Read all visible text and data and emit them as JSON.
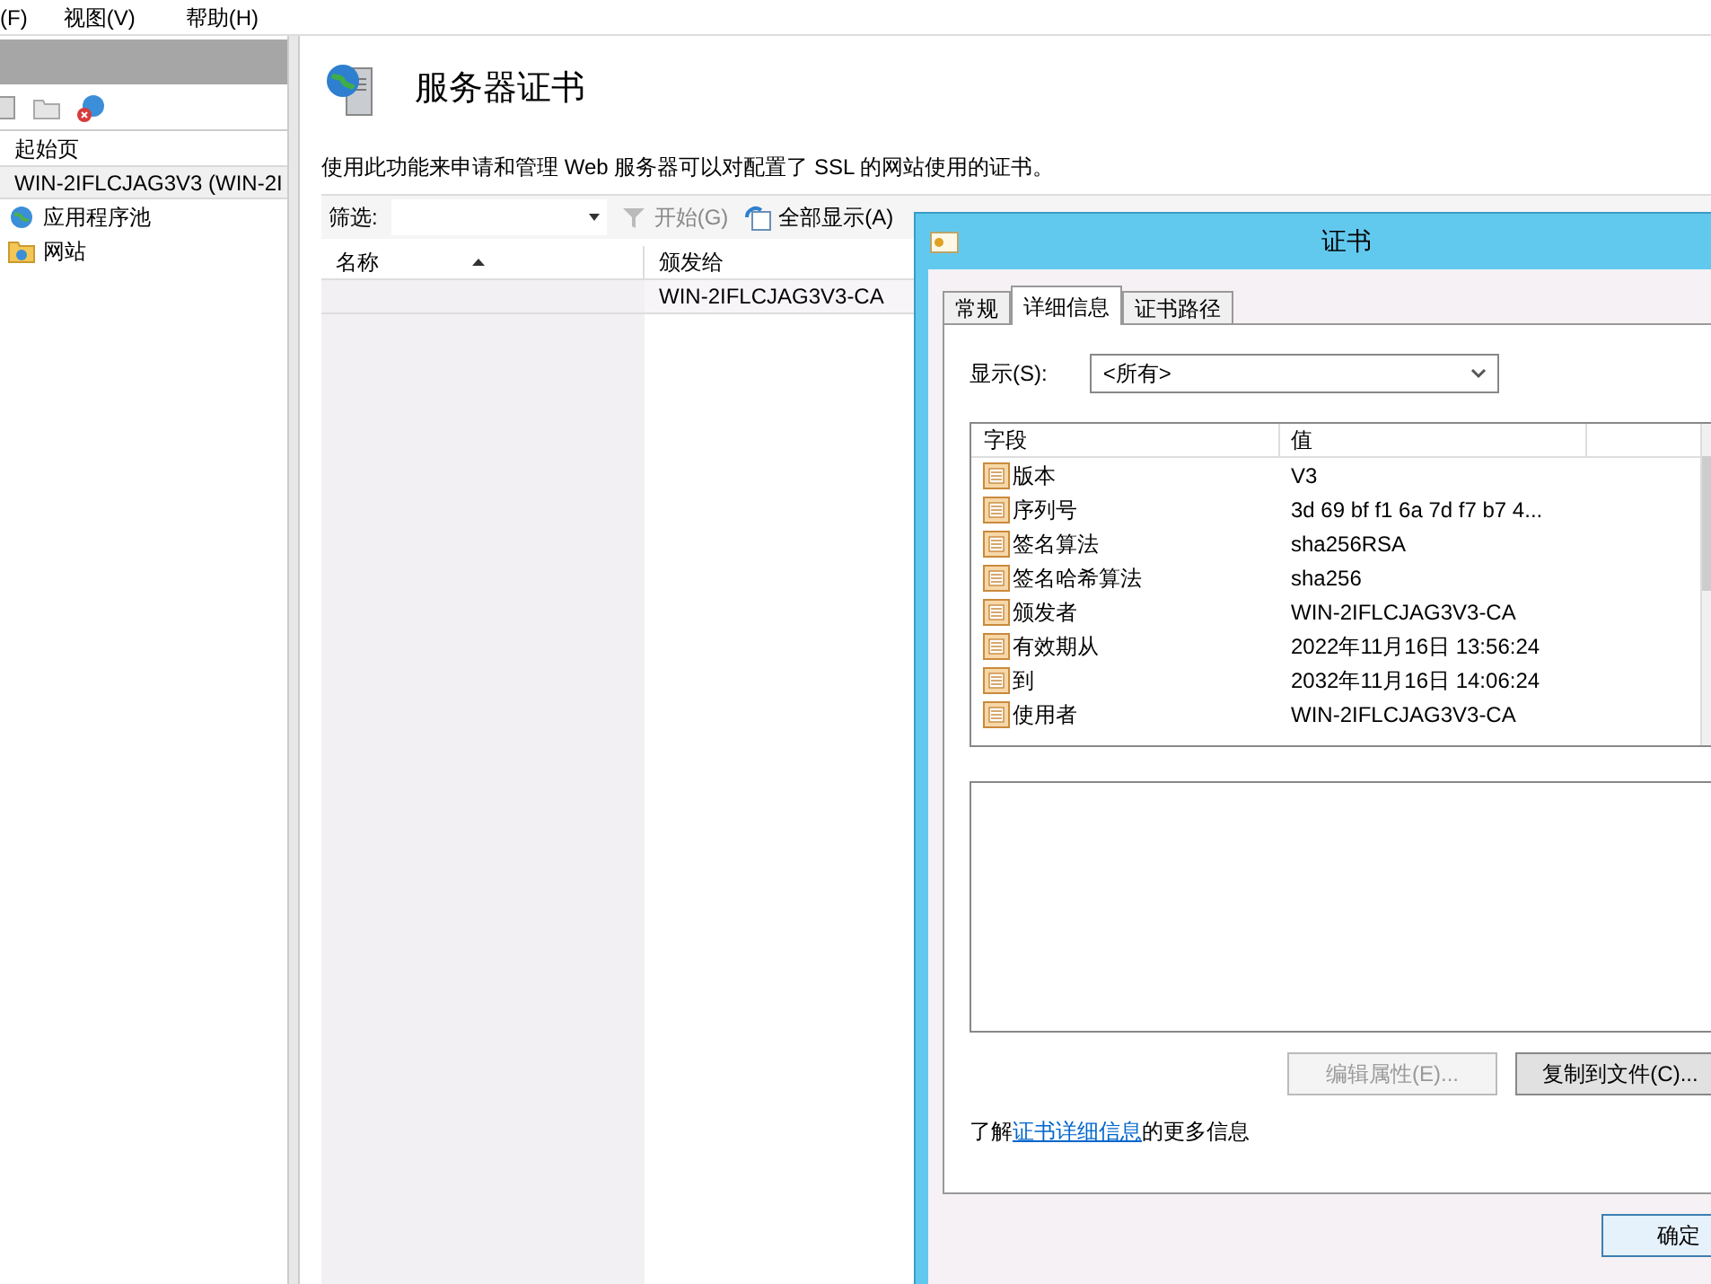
{
  "menu": [
    "(F)",
    "视图(V)",
    "帮助(H)"
  ],
  "tree": [
    {
      "label": "起始页",
      "selected": false
    },
    {
      "label": "WIN-2IFLCJAG3V3 (WIN-2I",
      "selected": true,
      "children": [
        {
          "label": "应用程序池",
          "selected": false,
          "kind": "pool"
        },
        {
          "label": "网站",
          "selected": false,
          "kind": "sites"
        }
      ]
    }
  ],
  "page": {
    "title": "服务器证书",
    "description": "使用此功能来申请和管理 Web 服务器可以对配置了 SSL 的网站使用的证书。"
  },
  "filter": {
    "label": "筛选:",
    "start": "开始(G)",
    "show_all": "全部显示(A)"
  },
  "table": {
    "columns": [
      "名称",
      "颁发给"
    ],
    "rows": [
      [
        "",
        "WIN-2IFLCJAG3V3-CA"
      ]
    ]
  },
  "dialog": {
    "title": "证书",
    "tabs": [
      {
        "label": "常规",
        "selected": false
      },
      {
        "label": "详细信息",
        "selected": true
      },
      {
        "label": "证书路径",
        "selected": false
      }
    ],
    "show_label": "显示(S):",
    "show_value": "<所有>",
    "columns": [
      "字段",
      "值"
    ],
    "fields": [
      {
        "field": "版本",
        "value": "V3"
      },
      {
        "field": "序列号",
        "value": "3d 69 bf f1 6a 7d f7 b7 4..."
      },
      {
        "field": "签名算法",
        "value": "sha256RSA"
      },
      {
        "field": "签名哈希算法",
        "value": "sha256"
      },
      {
        "field": "颁发者",
        "value": "WIN-2IFLCJAG3V3-CA"
      },
      {
        "field": "有效期从",
        "value": "2022年11月16日 13:56:24"
      },
      {
        "field": "到",
        "value": "2032年11月16日 14:06:24"
      },
      {
        "field": "使用者",
        "value": "WIN-2IFLCJAG3V3-CA"
      }
    ],
    "buttons": [
      {
        "label": "编辑属性(E)...",
        "disabled": true
      },
      {
        "label": "复制到文件(C)...",
        "disabled": false
      }
    ],
    "info_prefix": "了解",
    "info_link": "证书详细信息",
    "info_suffix": "的更多信息",
    "ok": "确定"
  }
}
